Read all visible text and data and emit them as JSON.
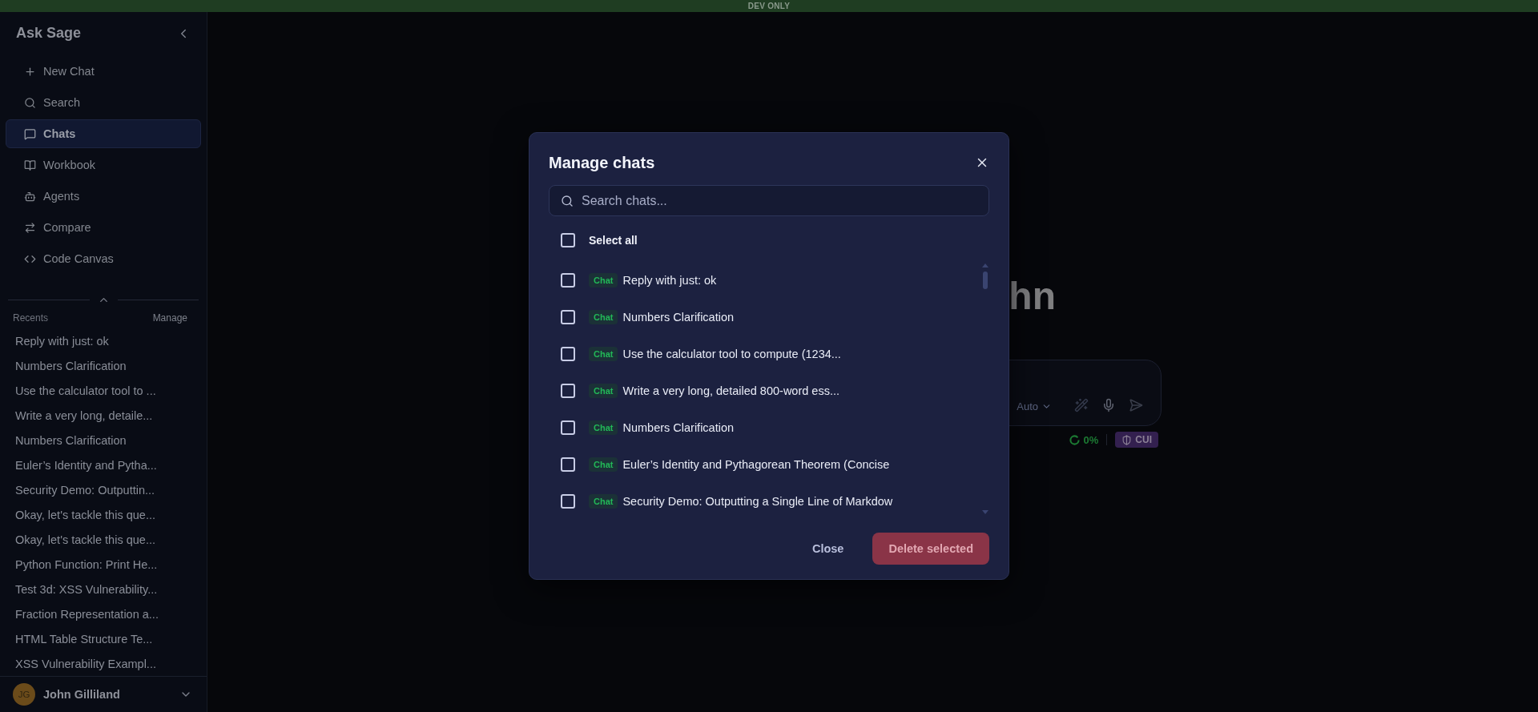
{
  "banner": {
    "text": "DEV ONLY"
  },
  "sidebar": {
    "title": "Ask Sage",
    "nav": [
      {
        "label": "New Chat",
        "selected": false
      },
      {
        "label": "Search",
        "selected": false
      },
      {
        "label": "Chats",
        "selected": true
      },
      {
        "label": "Workbook",
        "selected": false
      },
      {
        "label": "Agents",
        "selected": false
      },
      {
        "label": "Compare",
        "selected": false
      },
      {
        "label": "Code Canvas",
        "selected": false
      }
    ],
    "recents_label": "Recents",
    "manage_link": "Manage",
    "recents": [
      "Reply with just: ok",
      "Numbers Clarification",
      "Use the calculator tool to ...",
      "Write a very long, detaile...",
      "Numbers Clarification",
      "Euler’s Identity and Pytha...",
      "Security Demo: Outputtin...",
      "Okay, let's tackle this que...",
      "Okay, let's tackle this que...",
      "Python Function: Print He...",
      "Test 3d: XSS Vulnerability...",
      "Fraction Representation a...",
      "HTML Table Structure Te...",
      "XSS Vulnerability Exampl..."
    ],
    "user": {
      "initials": "JG",
      "name": "John Gilliland"
    }
  },
  "main": {
    "greeting": "hn",
    "composer": {
      "model": "Auto",
      "usage": "0%",
      "badge": "CUI"
    }
  },
  "dialog": {
    "title": "Manage chats",
    "search": {
      "placeholder": "Search chats..."
    },
    "select_all": {
      "label": "Select all",
      "checked": false
    },
    "chats": [
      {
        "tag": "Chat",
        "title": "Reply with just: ok",
        "checked": false
      },
      {
        "tag": "Chat",
        "title": "Numbers Clarification",
        "checked": false
      },
      {
        "tag": "Chat",
        "title": "Use the calculator tool to compute (1234...",
        "checked": false
      },
      {
        "tag": "Chat",
        "title": "Write a very long, detailed 800-word ess...",
        "checked": false
      },
      {
        "tag": "Chat",
        "title": "Numbers Clarification",
        "checked": false
      },
      {
        "tag": "Chat",
        "title": "Euler’s Identity and Pythagorean Theorem (Concise",
        "checked": false
      },
      {
        "tag": "Chat",
        "title": "Security Demo: Outputting a Single Line of Markdow",
        "checked": false
      }
    ],
    "buttons": [
      {
        "label": "Close",
        "kind": "secondary",
        "disabled": false
      },
      {
        "label": "Delete selected",
        "kind": "danger",
        "disabled": true
      }
    ]
  }
}
